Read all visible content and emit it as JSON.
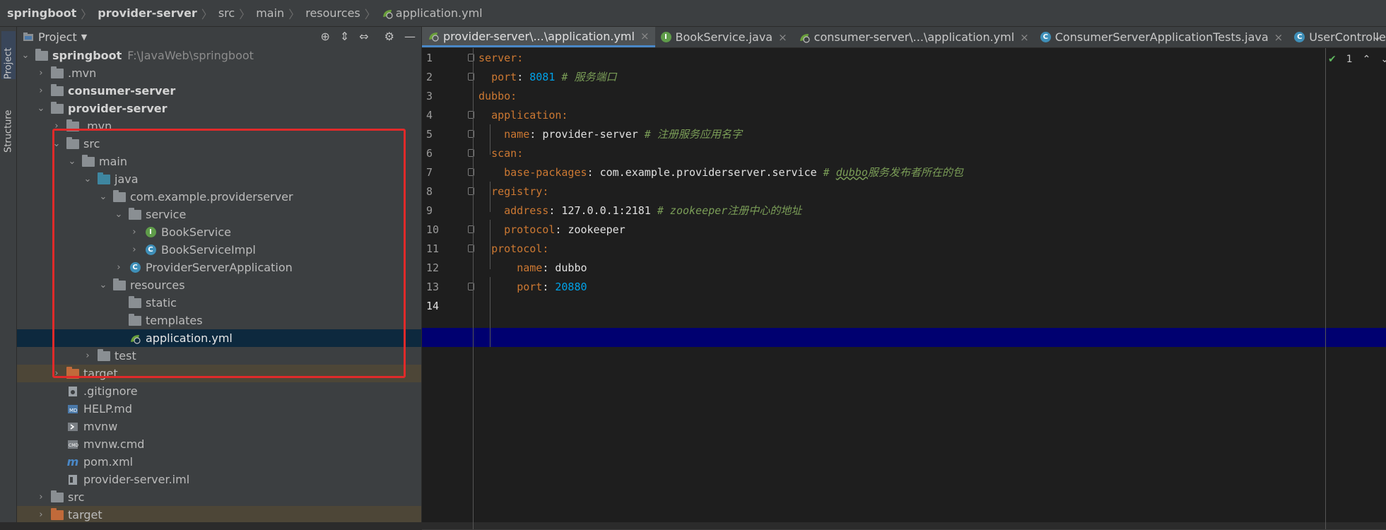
{
  "breadcrumb": {
    "items": [
      "springboot",
      "provider-server",
      "src",
      "main",
      "resources",
      "application.yml"
    ]
  },
  "left_strip": {
    "project_tab": "Project",
    "structure_tab": "Structure"
  },
  "project_panel": {
    "title": "Project",
    "tree": [
      {
        "label": "springboot",
        "hint": "F:\\JavaWeb\\springboot"
      },
      {
        "label": ".mvn"
      },
      {
        "label": "consumer-server"
      },
      {
        "label": "provider-server"
      },
      {
        "label": ".mvn"
      },
      {
        "label": "src"
      },
      {
        "label": "main"
      },
      {
        "label": "java"
      },
      {
        "label": "com.example.providerserver"
      },
      {
        "label": "service"
      },
      {
        "label": "BookService"
      },
      {
        "label": "BookServiceImpl"
      },
      {
        "label": "ProviderServerApplication"
      },
      {
        "label": "resources"
      },
      {
        "label": "static"
      },
      {
        "label": "templates"
      },
      {
        "label": "application.yml"
      },
      {
        "label": "test"
      },
      {
        "label": "target"
      },
      {
        "label": ".gitignore"
      },
      {
        "label": "HELP.md"
      },
      {
        "label": "mvnw"
      },
      {
        "label": "mvnw.cmd"
      },
      {
        "label": "pom.xml"
      },
      {
        "label": "provider-server.iml"
      },
      {
        "label": "src"
      },
      {
        "label": "target"
      }
    ]
  },
  "editor": {
    "tabs": [
      {
        "label": "provider-server\\...\\application.yml",
        "active": true
      },
      {
        "label": "BookService.java"
      },
      {
        "label": "consumer-server\\...\\application.yml"
      },
      {
        "label": "ConsumerServerApplicationTests.java"
      },
      {
        "label": "UserController.java"
      }
    ],
    "inspection_count": "1",
    "line_numbers": [
      "1",
      "2",
      "3",
      "4",
      "5",
      "6",
      "7",
      "8",
      "9",
      "10",
      "11",
      "12",
      "13",
      "14"
    ],
    "code": {
      "l1_key": "server",
      "l1_colon": ":",
      "l2_key": "port",
      "l2_colon": ": ",
      "l2_val": "8081",
      "l2_comment": " # 服务端口",
      "l3_key": "dubbo",
      "l3_colon": ":",
      "l4_key": "application",
      "l4_colon": ":",
      "l5_key": "name",
      "l5_colon": ": ",
      "l5_val": "provider-server",
      "l5_comment": " # 注册服务应用名字",
      "l6_key": "scan",
      "l6_colon": ":",
      "l7_key": "base-packages",
      "l7_colon": ": ",
      "l7_val": "com.example.providerserver.service",
      "l7_comment_a": " # ",
      "l7_comment_b": "dubbo",
      "l7_comment_c": "服务发布者所在的包",
      "l8_key": "registry",
      "l8_colon": ":",
      "l9_key": "address",
      "l9_colon": ": ",
      "l9_val": "127.0.0.1:2181",
      "l9_comment": " # zookeeper注册中心的地址",
      "l10_key": "protocol",
      "l10_colon": ": ",
      "l10_val": "zookeeper",
      "l11_key": "protocol",
      "l11_colon": ":",
      "l12_key": "name",
      "l12_colon": ": ",
      "l12_val": "dubbo",
      "l13_key": "port",
      "l13_colon": ": ",
      "l13_val": "20880"
    }
  },
  "colors": {
    "highlight_box": "#e02a2a",
    "current_line": "#000070",
    "keyword": "#cc7832",
    "number": "#00a2e8",
    "comment": "#7a9d57"
  }
}
